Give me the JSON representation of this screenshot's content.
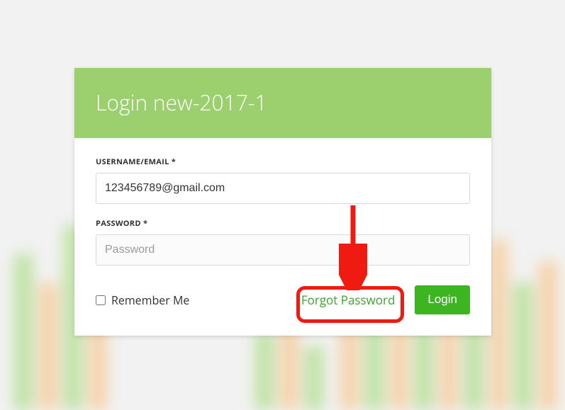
{
  "header": {
    "title": "Login new-2017-1"
  },
  "form": {
    "username_label": "USERNAME/EMAIL *",
    "username_value": "123456789@gmail.com",
    "password_label": "PASSWORD *",
    "password_placeholder": "Password"
  },
  "actions": {
    "remember_label": "Remember Me",
    "forgot_label": "Forgot Password",
    "login_label": "Login"
  }
}
